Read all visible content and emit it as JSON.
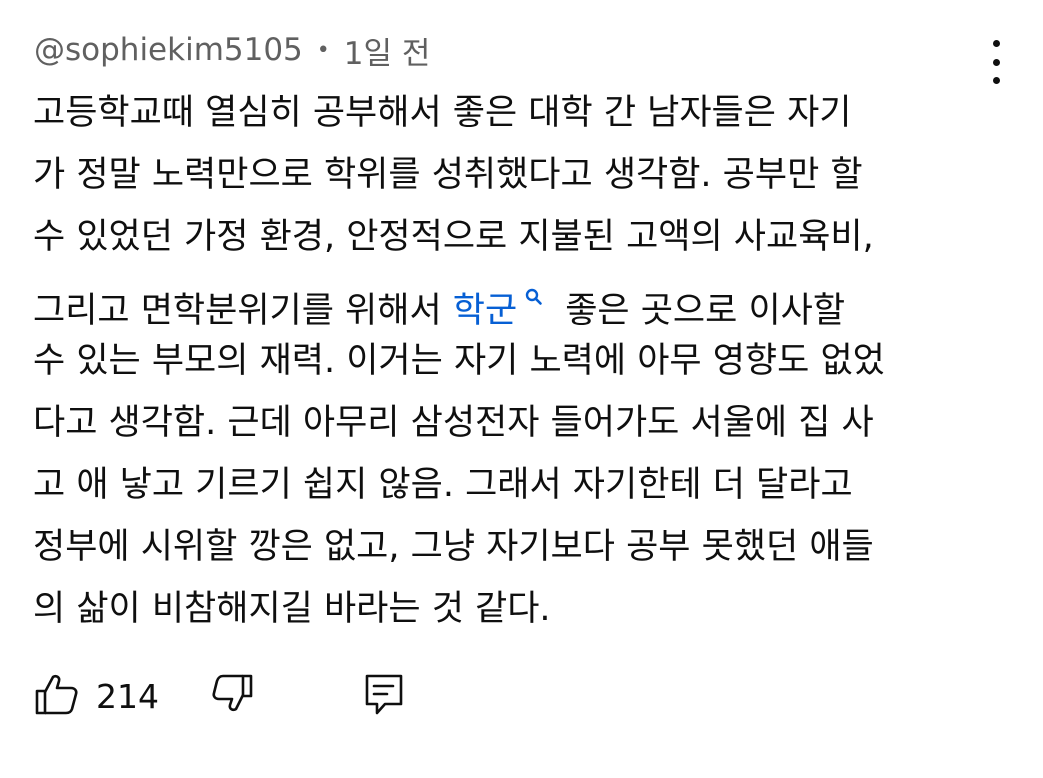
{
  "comment": {
    "author": "@sophiekim5105",
    "separator": "•",
    "time": "1일 전",
    "lines": [
      "고등학교때 열심히 공부해서 좋은 대학 간 남자들은 자기",
      "가 정말 노력만으로 학위를 성취했다고 생각함. 공부만 할",
      "수 있었던 가정 환경, 안정적으로 지불된 고액의 사교육비,",
      "그리고 면학분위기를 위해서",
      "수 있는 부모의 재력. 이거는 자기 노력에 아무 영향도 없었",
      "다고 생각함. 근데 아무리 삼성전자 들어가도 서울에 집 사",
      "고 애 낳고 기르기 쉽지 않음. 그래서 자기한테 더 달라고",
      "정부에 시위할 깡은 없고, 그냥 자기보다 공부 못했던 애들",
      "의 삶이 비참해지길 바라는 것 같다."
    ],
    "search_link": "학군",
    "line4_after_link": "좋은 곳으로 이사할",
    "like_count": "214"
  },
  "colors": {
    "text": "#0f0f0f",
    "meta": "#606060",
    "link": "#065fd4",
    "background": "#ffffff"
  },
  "icons": {
    "more": "more-vert-icon",
    "search": "search-icon",
    "like": "thumb-up-icon",
    "dislike": "thumb-down-icon",
    "reply": "reply-icon"
  }
}
